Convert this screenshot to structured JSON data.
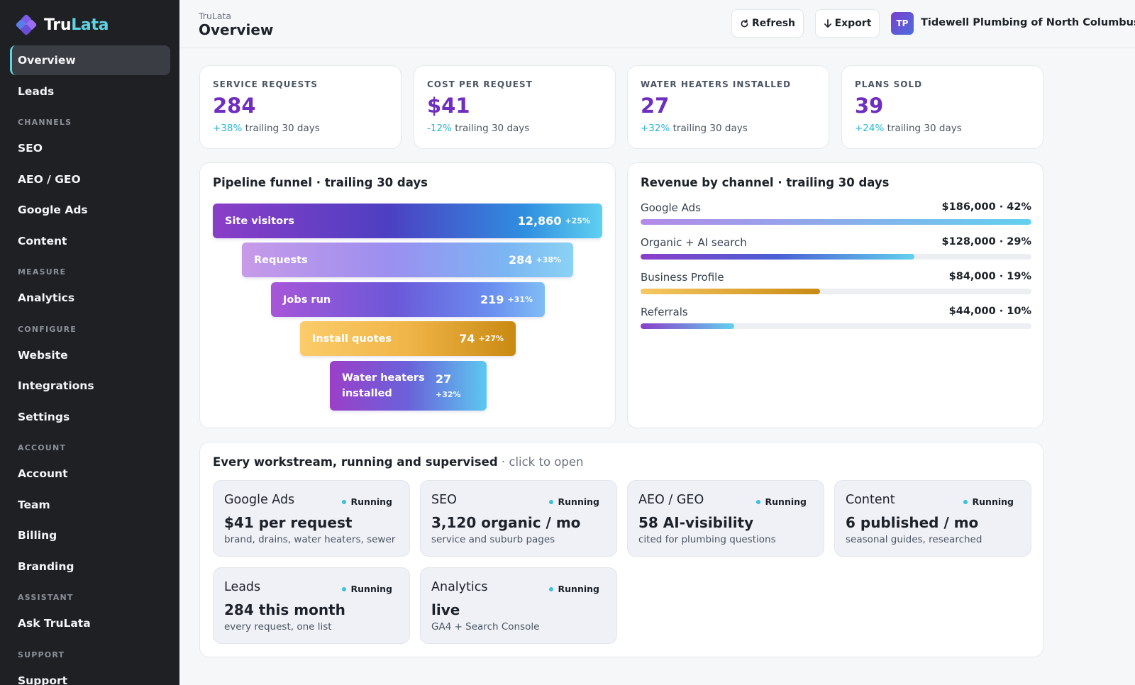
{
  "app": {
    "name_part1": "Tru",
    "name_part2": "Lata",
    "accent": "#5fd3e3",
    "brand_purple": "#6f2dc1"
  },
  "sidebar": {
    "items": [
      {
        "type": "item",
        "label": "Overview",
        "active": true
      },
      {
        "type": "item",
        "label": "Leads"
      },
      {
        "type": "section",
        "label": "CHANNELS"
      },
      {
        "type": "item",
        "label": "SEO"
      },
      {
        "type": "item",
        "label": "AEO / GEO"
      },
      {
        "type": "item",
        "label": "Google Ads"
      },
      {
        "type": "item",
        "label": "Content"
      },
      {
        "type": "section",
        "label": "MEASURE"
      },
      {
        "type": "item",
        "label": "Analytics"
      },
      {
        "type": "section",
        "label": "CONFIGURE"
      },
      {
        "type": "item",
        "label": "Website"
      },
      {
        "type": "item",
        "label": "Integrations"
      },
      {
        "type": "item",
        "label": "Settings"
      },
      {
        "type": "section",
        "label": "ACCOUNT"
      },
      {
        "type": "item",
        "label": "Account"
      },
      {
        "type": "item",
        "label": "Team"
      },
      {
        "type": "item",
        "label": "Billing"
      },
      {
        "type": "item",
        "label": "Branding"
      },
      {
        "type": "section",
        "label": "ASSISTANT"
      },
      {
        "type": "item",
        "label": "Ask TruLata"
      },
      {
        "type": "section",
        "label": "SUPPORT"
      },
      {
        "type": "item",
        "label": "Support"
      }
    ]
  },
  "header": {
    "breadcrumb": "TruLata",
    "title": "Overview",
    "refresh_icon": "refresh-icon",
    "refresh_label": "Refresh",
    "export_icon": "arrow-down-icon",
    "export_label": "Export",
    "avatar_initials": "TP",
    "org_name": "Tidewell Plumbing of North Columbus"
  },
  "stats": [
    {
      "label": "SERVICE REQUESTS",
      "value": "284",
      "delta": "+38%",
      "period": "trailing 30 days"
    },
    {
      "label": "COST PER REQUEST",
      "value": "$41",
      "delta": "-12%",
      "period": "trailing 30 days"
    },
    {
      "label": "WATER HEATERS INSTALLED",
      "value": "27",
      "delta": "+32%",
      "period": "trailing 30 days"
    },
    {
      "label": "PLANS SOLD",
      "value": "39",
      "delta": "+24%",
      "period": "trailing 30 days"
    }
  ],
  "funnel": {
    "title": "Pipeline funnel · trailing 30 days",
    "stages": [
      {
        "label": "Site visitors",
        "value": "12,860",
        "delta": "+25%"
      },
      {
        "label": "Requests",
        "value": "284",
        "delta": "+38%"
      },
      {
        "label": "Jobs run",
        "value": "219",
        "delta": "+31%"
      },
      {
        "label": "Install quotes",
        "value": "74",
        "delta": "+27%"
      },
      {
        "label": "Water heaters installed",
        "value": "27",
        "delta": "+32%"
      }
    ]
  },
  "revenue": {
    "title": "Revenue by channel · trailing 30 days",
    "channels": [
      {
        "name": "Google Ads",
        "value_text": "$186,000 · 42%",
        "share": 1.0,
        "colors": [
          "#b489e8",
          "#62d0ee"
        ]
      },
      {
        "name": "Organic + AI search",
        "value_text": "$128,000 · 29%",
        "share": 0.7,
        "colors": [
          "#8a3fc9",
          "#4a5fd4",
          "#62d0ee"
        ]
      },
      {
        "name": "Business Profile",
        "value_text": "$84,000 · 19%",
        "share": 0.46,
        "colors": [
          "#f6c863",
          "#c98a12"
        ]
      },
      {
        "name": "Referrals",
        "value_text": "$44,000 · 10%",
        "share": 0.24,
        "colors": [
          "#8a3fc9",
          "#62d0ee"
        ]
      }
    ]
  },
  "workstreams": {
    "title": "Every workstream, running and supervised",
    "subtitle": " · click to open",
    "items": [
      {
        "name": "Google Ads",
        "status": "Running",
        "metric": "$41 per request",
        "desc": "brand, drains, water heaters, sewer"
      },
      {
        "name": "SEO",
        "status": "Running",
        "metric": "3,120 organic / mo",
        "desc": "service and suburb pages"
      },
      {
        "name": "AEO / GEO",
        "status": "Running",
        "metric": "58 AI-visibility",
        "desc": "cited for plumbing questions"
      },
      {
        "name": "Content",
        "status": "Running",
        "metric": "6 published / mo",
        "desc": "seasonal guides, researched"
      },
      {
        "name": "Leads",
        "status": "Running",
        "metric": "284 this month",
        "desc": "every request, one list"
      },
      {
        "name": "Analytics",
        "status": "Running",
        "metric": "live",
        "desc": "GA4 + Search Console"
      }
    ]
  }
}
